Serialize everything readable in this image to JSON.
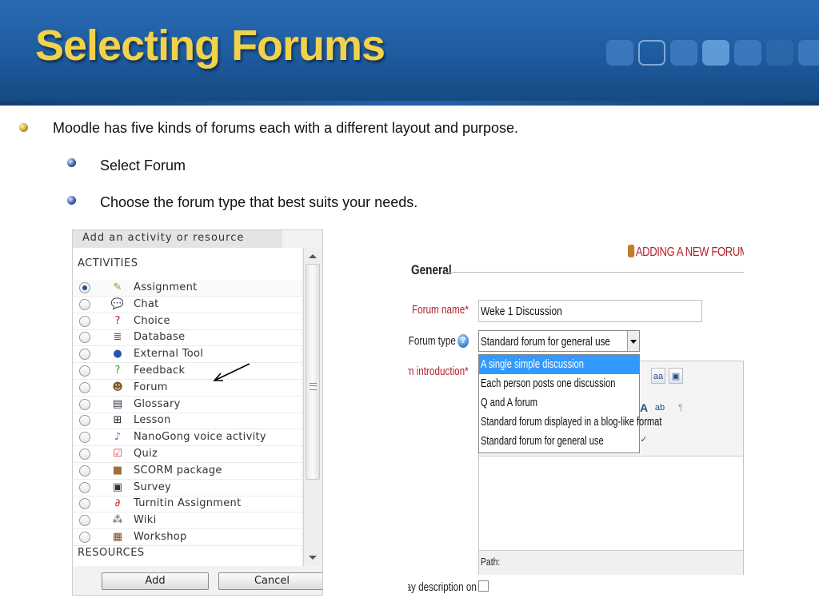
{
  "slide": {
    "title": "Selecting Forums",
    "bullets": [
      "Moodle has five kinds of forums each with a different layout and purpose.",
      "Select Forum",
      "Choose the forum type that best suits your needs."
    ]
  },
  "activity_chooser": {
    "title": "Add an activity or resource",
    "activities_heading": "ACTIVITIES",
    "resources_heading": "RESOURCES",
    "items": [
      {
        "label": "Assignment",
        "icon": "assignment-icon",
        "glyph": "✎",
        "selected": true
      },
      {
        "label": "Chat",
        "icon": "chat-icon",
        "glyph": "💬"
      },
      {
        "label": "Choice",
        "icon": "choice-icon",
        "glyph": "?"
      },
      {
        "label": "Database",
        "icon": "database-icon",
        "glyph": "≣"
      },
      {
        "label": "External Tool",
        "icon": "external-tool-icon",
        "glyph": "●"
      },
      {
        "label": "Feedback",
        "icon": "feedback-icon",
        "glyph": "?"
      },
      {
        "label": "Forum",
        "icon": "forum-icon",
        "glyph": "☻"
      },
      {
        "label": "Glossary",
        "icon": "glossary-icon",
        "glyph": "▤"
      },
      {
        "label": "Lesson",
        "icon": "lesson-icon",
        "glyph": "⊞"
      },
      {
        "label": "NanoGong voice activity",
        "icon": "nanogong-icon",
        "glyph": "♪"
      },
      {
        "label": "Quiz",
        "icon": "quiz-icon",
        "glyph": "☑"
      },
      {
        "label": "SCORM package",
        "icon": "scorm-package-icon",
        "glyph": "■"
      },
      {
        "label": "Survey",
        "icon": "survey-icon",
        "glyph": "▣"
      },
      {
        "label": "Turnitin Assignment",
        "icon": "turnitin-icon",
        "glyph": "∂"
      },
      {
        "label": "Wiki",
        "icon": "wiki-icon",
        "glyph": "⁂"
      },
      {
        "label": "Workshop",
        "icon": "workshop-icon",
        "glyph": "▦"
      }
    ],
    "add_label": "Add",
    "cancel_label": "Cancel"
  },
  "forum_form": {
    "page_heading": "ADDING A NEW FORUM",
    "section_legend": "General",
    "forum_name_label": "Forum name*",
    "forum_name_value": "Weke 1 Discussion",
    "forum_type_label": "Forum type",
    "forum_type_selected": "Standard forum for general use",
    "forum_type_options": [
      "A single simple discussion",
      "Each person posts one discussion",
      "Q and A forum",
      "Standard forum displayed in a blog-like format",
      "Standard forum for general use"
    ],
    "highlighted_option_index": 0,
    "intro_label": "orum introduction*",
    "editor_path_label": "Path:",
    "display_description_label": "isplay description on"
  },
  "colors": {
    "header_blue": "#1d5a9e",
    "title_gold": "#f2d24a",
    "required_red": "#b4202a",
    "highlight_blue": "#3399ff"
  }
}
